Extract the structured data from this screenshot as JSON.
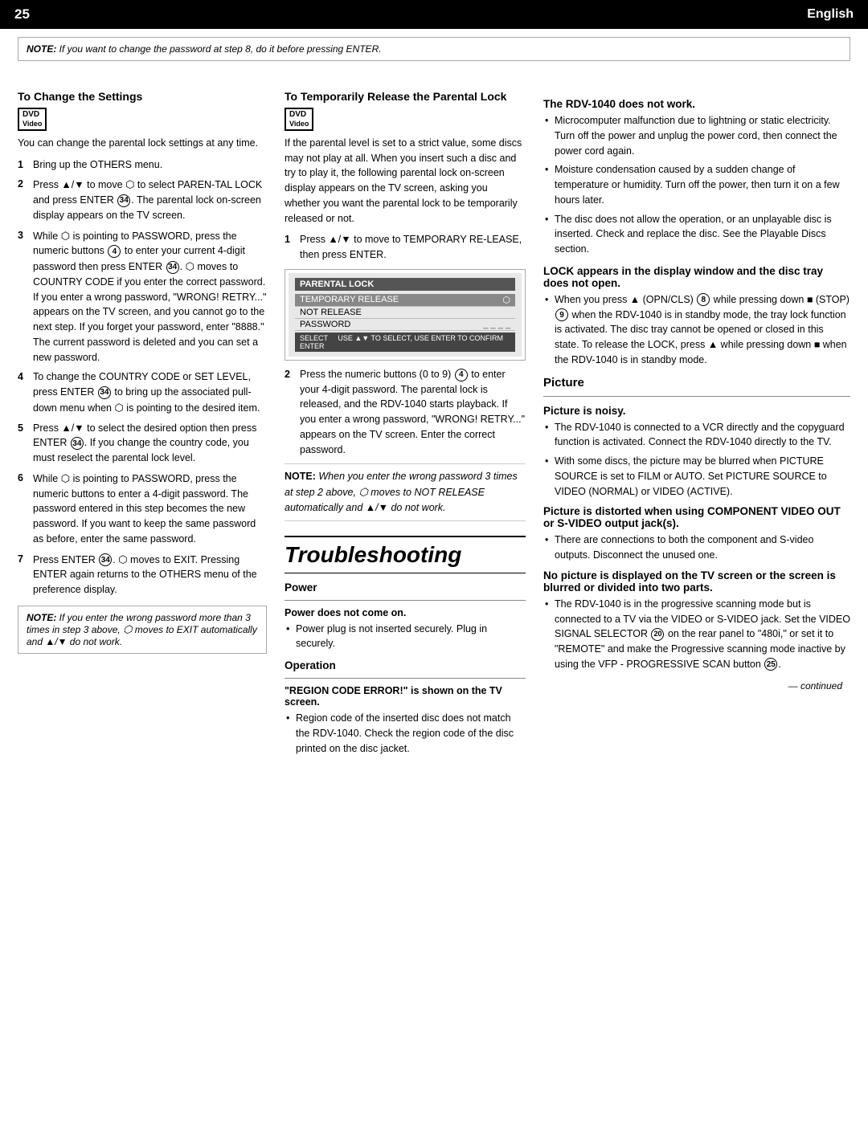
{
  "header": {
    "page_num": "25",
    "language": "English"
  },
  "note_top": {
    "bold": "NOTE:",
    "text": " If you want to change the password at step 8, do it before pressing ENTER."
  },
  "left_column": {
    "section1": {
      "heading": "To Change the Settings",
      "dvd_label": "DVD\nVideo",
      "intro": "You can change the parental lock settings at any time.",
      "steps": [
        {
          "num": "1",
          "text": "Bring up the OTHERS menu."
        },
        {
          "num": "2",
          "text": "Press ▲/▼ to move  to select PAREN-TAL LOCK and press ENTER . The parental lock on-screen display appears on the TV screen."
        },
        {
          "num": "3",
          "text": "While  is pointing to PASSWORD, press the numeric buttons  to enter your current 4-digit password then press ENTER .  moves to COUNTRY CODE if you enter the correct password. If you enter a wrong password, \"WRONG! RETRY...\" appears on the TV screen, and you cannot go to the next step. If you forget your password, enter \"8888.\" The current password is deleted and you can set a new password."
        },
        {
          "num": "4",
          "text": "To change the COUNTRY CODE or SET LEVEL, press ENTER  to bring up the associated pull-down menu when  is pointing to the desired item."
        },
        {
          "num": "5",
          "text": "Press ▲/▼ to select the desired option then press ENTER . If you change the country code, you must reselect the parental lock level."
        },
        {
          "num": "6",
          "text": "While  is pointing to PASSWORD, press the numeric buttons to enter a 4-digit password. The password entered in this step becomes the new password. If you want to keep the same password as before, enter the same password."
        },
        {
          "num": "7",
          "text": "Press ENTER .  moves to EXIT. Pressing ENTER again returns to the OTHERS menu of the preference display."
        }
      ],
      "note_bottom": {
        "bold": "NOTE:",
        "text": " If you enter the wrong password more than 3 times in step 3 above,  moves to EXIT automatically and ▲/▼ do not work."
      }
    }
  },
  "middle_column": {
    "section2": {
      "heading": "To Temporarily Release the Parental Lock",
      "dvd_label": "DVD\nVideo",
      "intro": "If the parental level is set to a strict value, some discs may not play at all. When you insert such a disc and try to play it, the following parental lock on-screen display appears on the TV screen, asking you whether you want the parental lock to be temporarily released or not.",
      "step1": {
        "num": "1",
        "text": "Press ▲/▼ to move to TEMPORARY RELEASE, then press ENTER."
      },
      "screen": {
        "title": "PARENTAL LOCK",
        "rows": [
          {
            "label": "TEMPORARY RELEASE",
            "selected": true
          },
          {
            "label": "NOT RELEASE",
            "selected": false
          },
          {
            "label": "PASSWORD",
            "value": "_ _ _ _",
            "selected": false
          }
        ],
        "footer": "SELECT    USE ▲▼ TO SELECT, USE ENTER TO CONFIRM\nENTER"
      },
      "step2": {
        "num": "2",
        "text": "Press the numeric buttons (0 to 9)  to enter your 4-digit password. The parental lock is released, and the RDV-1040 starts playback. If you enter a wrong password, \"WRONG! RETRY...\" appears on the TV screen. Enter the correct password."
      },
      "note": {
        "bold": "NOTE:",
        "text": " When you enter the wrong password 3 times at step 2 above,  moves to NOT RELEASE automatically and ▲/▼ do not work."
      }
    }
  },
  "troubleshooting": {
    "title": "Troubleshooting",
    "power": {
      "heading": "Power",
      "subheading": "Power does not come on.",
      "bullets": [
        "Power plug is not inserted securely. Plug in securely."
      ]
    },
    "operation": {
      "heading": "Operation",
      "subheading": "\"REGION CODE ERROR!\" is shown on the TV screen.",
      "bullets": [
        "Region code of the inserted disc does not match the RDV-1040. Check the region code of the disc printed on the disc jacket."
      ]
    }
  },
  "right_column": {
    "rdv_not_work": {
      "heading": "The RDV-1040 does not work.",
      "bullets": [
        "Microcomputer malfunction due to lightning or static electricity. Turn off the power and unplug the power cord, then connect the power cord again.",
        "Moisture condensation caused by a sudden change of temperature or humidity. Turn off the power, then turn it on a few hours later.",
        "The disc does not allow the operation, or an unplayable disc is inserted. Check and replace the disc. See the Playable Discs section."
      ]
    },
    "lock_appears": {
      "heading": "LOCK appears in the display window and the disc tray does not open.",
      "bullets": [
        "When you press ▲ (OPN/CLS)  while pressing down ■ (STOP)  when the RDV-1040 is in standby mode, the tray lock function is activated. The disc tray cannot be opened or closed in this state. To release the LOCK, press ▲ while pressing down ■ when the RDV-1040 is in standby mode."
      ]
    },
    "picture": {
      "heading": "Picture",
      "subheadings": [
        {
          "title": "Picture is noisy.",
          "bullets": [
            "The RDV-1040 is connected to a VCR directly and the copyguard function is activated. Connect the RDV-1040 directly to the TV.",
            "With some discs, the picture may be blurred when PICTURE SOURCE is set to FILM or AUTO. Set PICTURE SOURCE to VIDEO (NORMAL) or VIDEO (ACTIVE)."
          ]
        },
        {
          "title": "Picture is distorted when using COMPONENT VIDEO OUT or S-VIDEO output jack(s).",
          "bullets": [
            "There are connections to both the component and S-video outputs. Disconnect the unused one."
          ]
        },
        {
          "title": "No picture is displayed on the TV screen or the screen is blurred or divided into two parts.",
          "bullets": [
            "The RDV-1040 is in the progressive scanning mode but is connected to a TV via the VIDEO or S-VIDEO jack. Set the VIDEO SIGNAL SELECTOR  on the rear panel to \"480i,\" or set it to \"REMOTE\" and make the Progressive scanning mode inactive by using the VFP - PROGRESSIVE SCAN button ."
          ]
        }
      ]
    },
    "continued": "— continued"
  }
}
